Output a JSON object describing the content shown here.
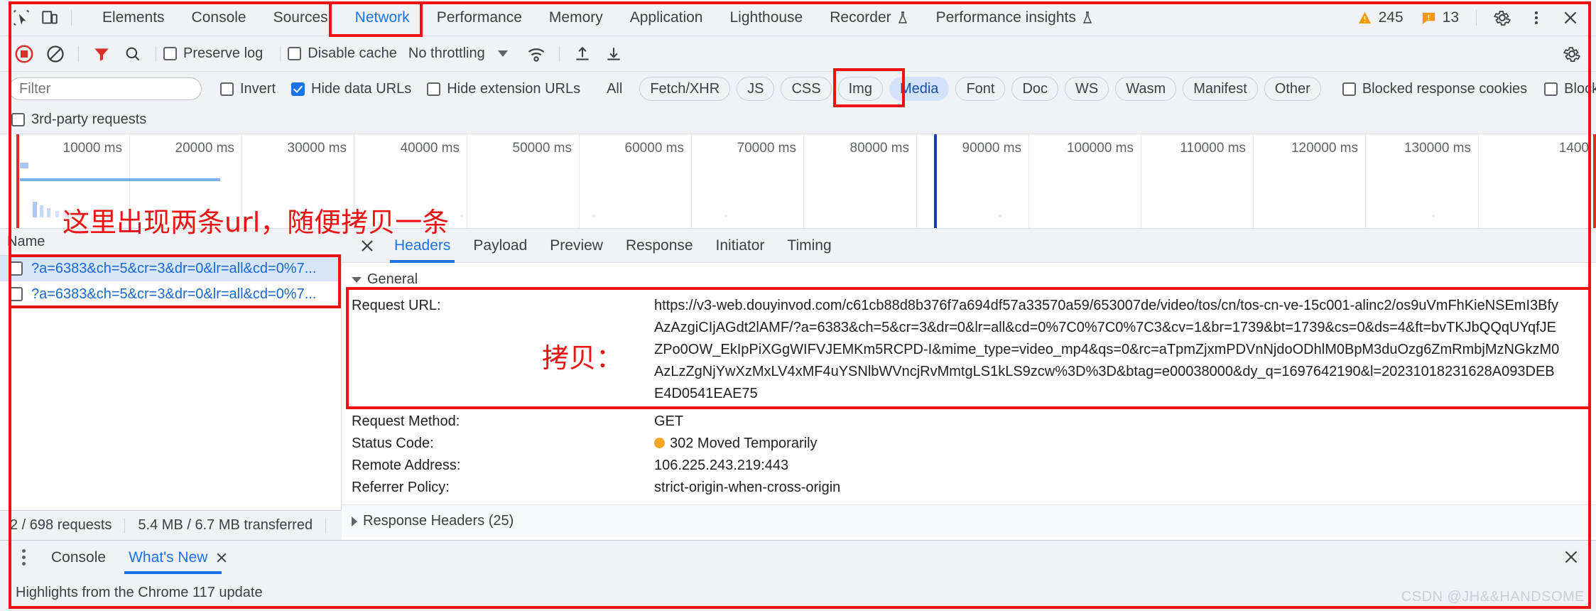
{
  "window": {
    "app": "Chrome DevTools",
    "warnings_count": "245",
    "errors_count": "13"
  },
  "tabbar": {
    "icons": [
      "inspect-element-icon",
      "device-toolbar-icon"
    ],
    "tabs": [
      {
        "label": "Elements",
        "active": false
      },
      {
        "label": "Console",
        "active": false
      },
      {
        "label": "Sources",
        "active": false
      },
      {
        "label": "Network",
        "active": true
      },
      {
        "label": "Performance",
        "active": false
      },
      {
        "label": "Memory",
        "active": false
      },
      {
        "label": "Application",
        "active": false
      },
      {
        "label": "Lighthouse",
        "active": false
      },
      {
        "label": "Recorder",
        "active": false,
        "flask": true
      },
      {
        "label": "Performance insights",
        "active": false,
        "flask": true
      }
    ]
  },
  "toolbar": {
    "record_title": "Stop recording network log",
    "clear_title": "Clear network log",
    "filter_title": "Filter",
    "search_title": "Search",
    "preserve_log": {
      "label": "Preserve log",
      "checked": false
    },
    "disable_cache": {
      "label": "Disable cache",
      "checked": false
    },
    "throttling": "No throttling",
    "import_title": "Import HAR file",
    "export_title": "Export HAR file",
    "settings_title": "Network settings"
  },
  "filterbar": {
    "filter_placeholder": "Filter",
    "filter_value": "",
    "invert": {
      "label": "Invert",
      "checked": false
    },
    "hide_data_urls": {
      "label": "Hide data URLs",
      "checked": true
    },
    "hide_extension_urls": {
      "label": "Hide extension URLs",
      "checked": false
    },
    "types": [
      {
        "label": "All",
        "selected": false
      },
      {
        "label": "Fetch/XHR",
        "selected": false
      },
      {
        "label": "JS",
        "selected": false
      },
      {
        "label": "CSS",
        "selected": false
      },
      {
        "label": "Img",
        "selected": false
      },
      {
        "label": "Media",
        "selected": true
      },
      {
        "label": "Font",
        "selected": false
      },
      {
        "label": "Doc",
        "selected": false
      },
      {
        "label": "WS",
        "selected": false
      },
      {
        "label": "Wasm",
        "selected": false
      },
      {
        "label": "Manifest",
        "selected": false
      },
      {
        "label": "Other",
        "selected": false
      }
    ],
    "blocked_response_cookies": {
      "label": "Blocked response cookies",
      "checked": false
    },
    "blocked_requests": {
      "label": "Blocked requests",
      "checked": false
    },
    "third_party_requests": {
      "label": "3rd-party requests",
      "checked": false
    }
  },
  "overview": {
    "tick_labels": [
      "10000 ms",
      "20000 ms",
      "30000 ms",
      "40000 ms",
      "50000 ms",
      "60000 ms",
      "70000 ms",
      "80000 ms",
      "90000 ms",
      "100000 ms",
      "110000 ms",
      "120000 ms",
      "130000 ms",
      "1400"
    ]
  },
  "requests": {
    "column_header": "Name",
    "rows": [
      {
        "name": "?a=6383&ch=5&cr=3&dr=0&lr=all&cd=0%7...",
        "selected": true
      },
      {
        "name": "?a=6383&ch=5&cr=3&dr=0&lr=all&cd=0%7...",
        "selected": false
      }
    ],
    "status_requests": "2 / 698 requests",
    "status_transferred": "5.4 MB / 6.7 MB transferred"
  },
  "detail": {
    "close_title": "Close",
    "tabs": [
      {
        "label": "Headers",
        "active": true
      },
      {
        "label": "Payload",
        "active": false
      },
      {
        "label": "Preview",
        "active": false
      },
      {
        "label": "Response",
        "active": false
      },
      {
        "label": "Initiator",
        "active": false
      },
      {
        "label": "Timing",
        "active": false
      }
    ],
    "general_section": "General",
    "fields": [
      {
        "key": "Request URL:",
        "value": "https://v3-web.douyinvod.com/c61cb88d8b376f7a694df57a33570a59/653007de/video/tos/cn/tos-cn-ve-15c001-alinc2/os9uVmFhKieNSEmI3BfyAzAzgiCIjAGdt2lAMF/?a=6383&ch=5&cr=3&dr=0&lr=all&cd=0%7C0%7C0%7C3&cv=1&br=1739&bt=1739&cs=0&ds=4&ft=bvTKJbQQqUYqfJEZPo0OW_EkIpPiXGgWIFVJEMKm5RCPD-I&mime_type=video_mp4&qs=0&rc=aTpmZjxmPDVnNjdoODhlM0BpM3duOzg6ZmRmbjMzNGkzM0AzLzZgNjYwXzMxLV4xMF4uYSNlbWVncjRvMmtgLS1kLS9zcw%3D%3D&btag=e00038000&dy_q=1697642190&l=20231018231628A093DEBE4D0541EAE75"
      },
      {
        "key": "Request Method:",
        "value": "GET"
      },
      {
        "key": "Status Code:",
        "value": "302 Moved Temporarily",
        "status_dot": "#f5a623"
      },
      {
        "key": "Remote Address:",
        "value": "106.225.243.219:443"
      },
      {
        "key": "Referrer Policy:",
        "value": "strict-origin-when-cross-origin"
      }
    ],
    "response_headers_section": "Response Headers (25)"
  },
  "drawer": {
    "more_title": "More tools",
    "tabs": [
      {
        "label": "Console",
        "active": false,
        "closable": false
      },
      {
        "label": "What's New",
        "active": true,
        "closable": true
      }
    ],
    "content": "Highlights from the Chrome 117 update",
    "close_title": "Close drawer"
  },
  "annotations": {
    "note_two_urls": "这里出现两条url，随便拷贝一条",
    "note_copy": "拷贝：",
    "highlight_color": "#ee1111"
  },
  "watermark": "CSDN @JH&&HANDSOME"
}
